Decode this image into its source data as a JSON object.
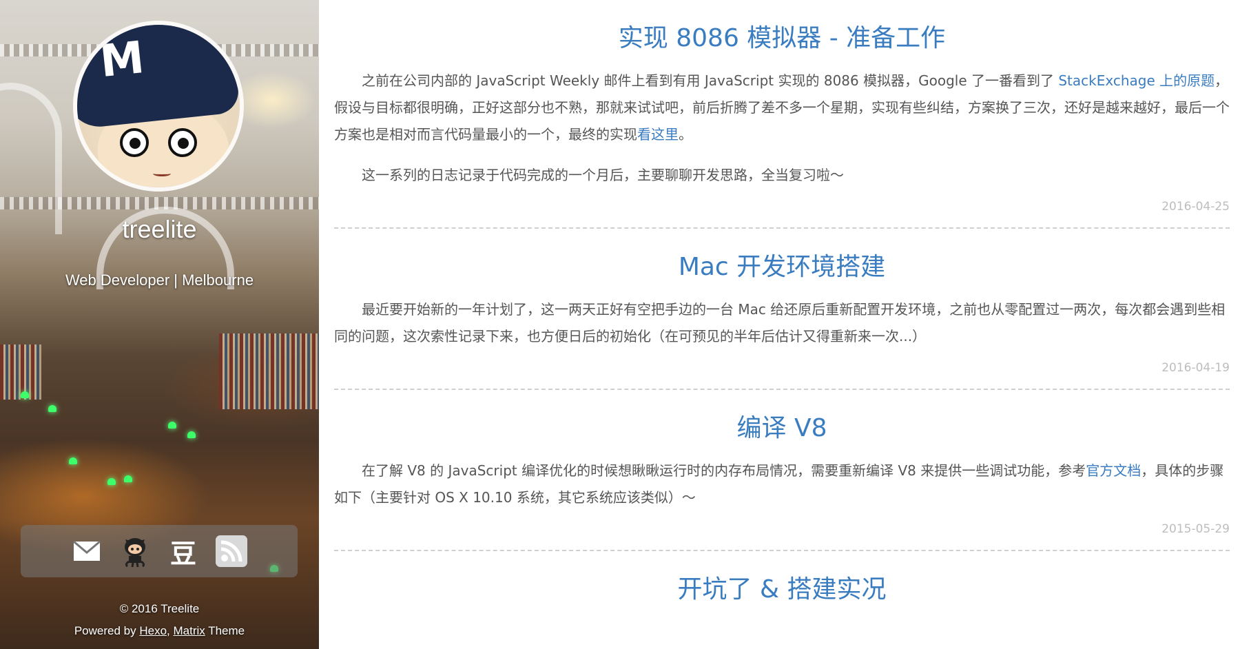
{
  "sidebar": {
    "site_name": "treelite",
    "subtitle": "Web Developer | Melbourne",
    "avatar_letter": "M",
    "social": [
      {
        "name": "mail-icon",
        "glyph": "✉"
      },
      {
        "name": "github-icon",
        "glyph": ""
      },
      {
        "name": "douban-icon",
        "glyph": "豆"
      },
      {
        "name": "rss-icon",
        "glyph": ""
      }
    ],
    "footer": {
      "copyright": "© 2016 Treelite",
      "powered_by": "Powered by",
      "hexo": "Hexo",
      "comma": ",",
      "matrix": "Matrix",
      "theme": "Theme"
    }
  },
  "posts": [
    {
      "title": "实现 8086 模拟器 - 准备工作",
      "p1_a": "之前在公司内部的 JavaScript Weekly 邮件上看到有用 JavaScript 实现的 8086 模拟器，Google 了一番看到了 ",
      "p1_link1": "StackExchage 上的原题",
      "p1_b": "，假设与目标都很明确，正好这部分也不熟，那就来试试吧，前后折腾了差不多一个星期，实现有些纠结，方案换了三次，还好是越来越好，最后一个方案也是相对而言代码量最小的一个，最终的实现",
      "p1_link2": "看这里",
      "p1_c": "。",
      "p2": "这一系列的日志记录于代码完成的一个月后，主要聊聊开发思路，全当复习啦～",
      "date": "2016-04-25"
    },
    {
      "title": "Mac 开发环境搭建",
      "p1": "最近要开始新的一年计划了，这一两天正好有空把手边的一台 Mac 给还原后重新配置开发环境，之前也从零配置过一两次，每次都会遇到些相同的问题，这次索性记录下来，也方便日后的初始化（在可预见的半年后估计又得重新来一次...）",
      "date": "2016-04-19"
    },
    {
      "title": "编译 V8",
      "p1_a": "在了解 V8 的 JavaScript 编译优化的时候想瞅瞅运行时的内存布局情况，需要重新编译 V8 来提供一些调试功能，参考",
      "p1_link1": "官方文档",
      "p1_b": "，具体的步骤如下（主要针对 OS X 10.10 系统，其它系统应该类似）～",
      "date": "2015-05-29"
    },
    {
      "title": "开坑了 & 搭建实况"
    }
  ],
  "colors": {
    "link": "#3a7cc0",
    "text": "#555555",
    "date": "#bdbdbd",
    "divider": "#cfcfcf"
  }
}
